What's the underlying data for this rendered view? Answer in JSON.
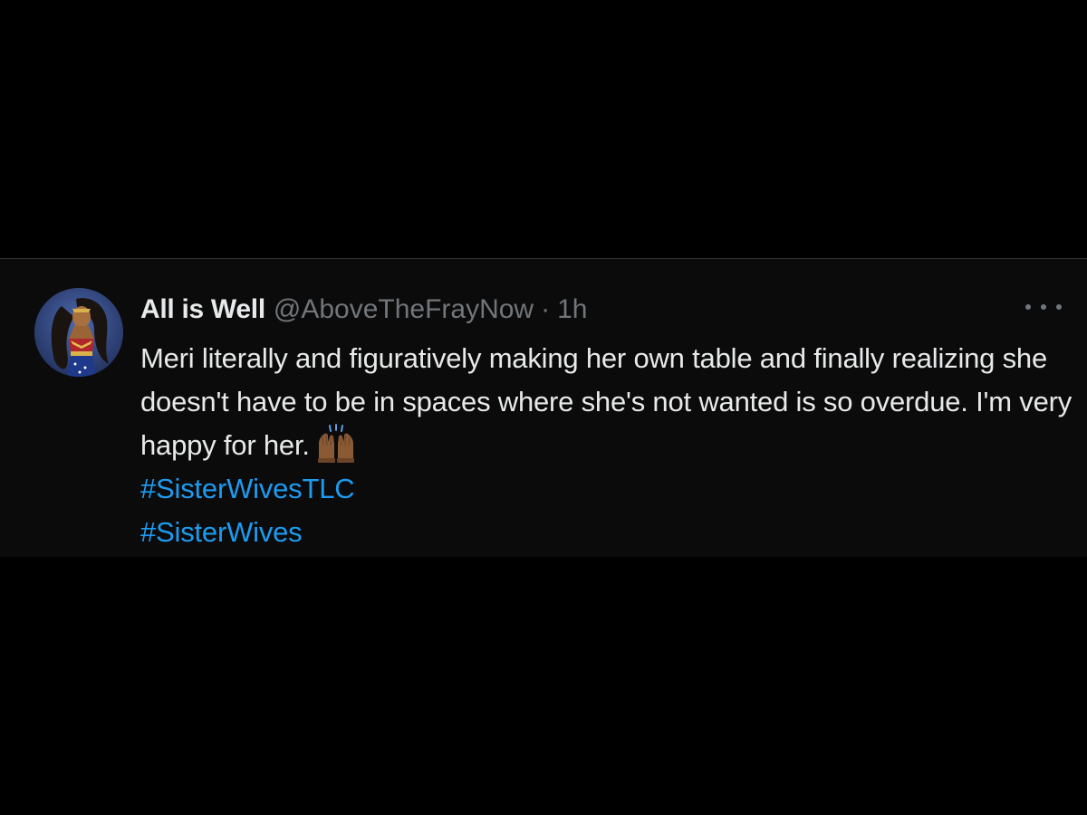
{
  "tweet": {
    "display_name": "All is Well",
    "handle": "@AboveTheFrayNow",
    "separator": "·",
    "timestamp": "1h",
    "text": "Meri literally and figuratively making her own table and finally realizing she doesn't have to be in spaces where she's not wanted is so overdue. I'm very happy for her.",
    "emoji": "raising-hands-emoji",
    "hashtags": [
      "#SisterWivesTLC",
      "#SisterWives"
    ],
    "more_icon": "more-dots-icon"
  },
  "colors": {
    "background": "#000000",
    "card": "#0b0b0b",
    "primary_text": "#e7e9ea",
    "secondary_text": "#71767b",
    "link": "#1d9bf0"
  }
}
